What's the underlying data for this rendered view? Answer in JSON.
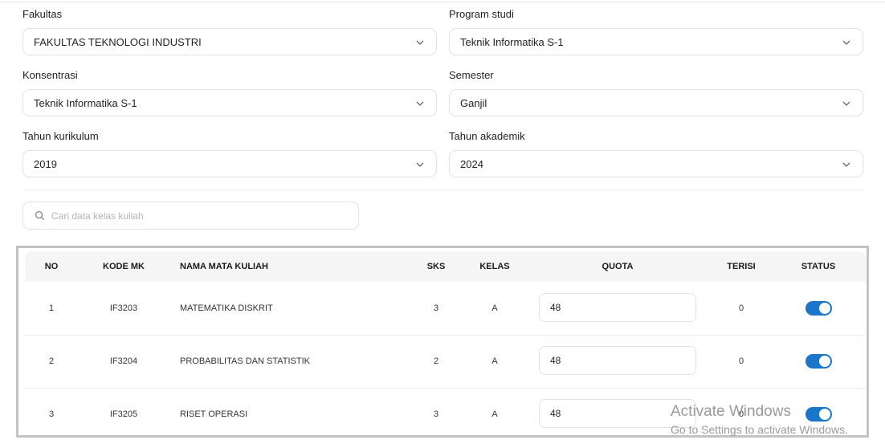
{
  "filters": {
    "fakultas": {
      "label": "Fakultas",
      "value": "FAKULTAS TEKNOLOGI INDUSTRI"
    },
    "program_studi": {
      "label": "Program studi",
      "value": "Teknik Informatika S-1"
    },
    "konsentrasi": {
      "label": "Konsentrasi",
      "value": "Teknik Informatika S-1"
    },
    "semester": {
      "label": "Semester",
      "value": "Ganjil"
    },
    "tahun_kurikulum": {
      "label": "Tahun kurikulum",
      "value": "2019"
    },
    "tahun_akademik": {
      "label": "Tahun akademik",
      "value": "2024"
    }
  },
  "search": {
    "placeholder": "Cari data kelas kuliah",
    "value": ""
  },
  "table": {
    "headers": {
      "no": "NO",
      "kode_mk": "KODE MK",
      "nama": "NAMA MATA KULIAH",
      "sks": "SKS",
      "kelas": "KELAS",
      "quota": "QUOTA",
      "terisi": "TERISI",
      "status": "STATUS"
    },
    "rows": [
      {
        "no": "1",
        "kode_mk": "IF3203",
        "nama": "MATEMATIKA DISKRIT",
        "sks": "3",
        "kelas": "A",
        "quota": "48",
        "terisi": "0",
        "status": true
      },
      {
        "no": "2",
        "kode_mk": "IF3204",
        "nama": "PROBABILITAS DAN STATISTIK",
        "sks": "2",
        "kelas": "A",
        "quota": "48",
        "terisi": "0",
        "status": true
      },
      {
        "no": "3",
        "kode_mk": "IF3205",
        "nama": "RISET OPERASI",
        "sks": "3",
        "kelas": "A",
        "quota": "48",
        "terisi": "0",
        "status": true
      }
    ]
  },
  "watermark": {
    "line1": "Activate Windows",
    "line2": "Go to Settings to activate Windows."
  },
  "colors": {
    "toggle_on": "#1976c9",
    "selection_border": "#c3c3c3"
  }
}
